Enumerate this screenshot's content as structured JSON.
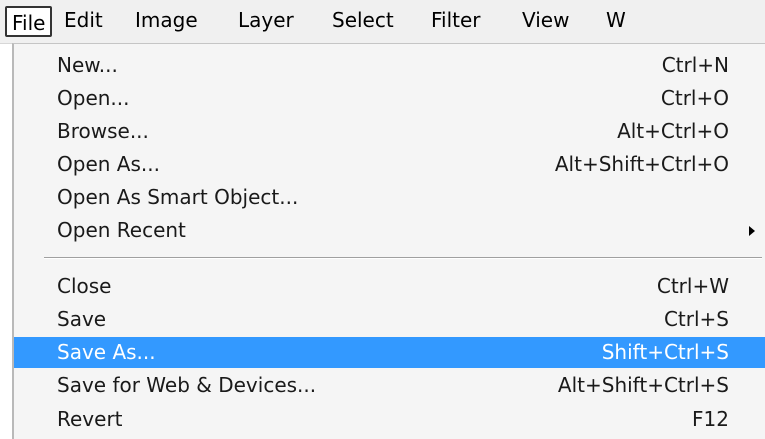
{
  "menubar": {
    "items": [
      {
        "label": "File",
        "active": true
      },
      {
        "label": "Edit"
      },
      {
        "label": "Image"
      },
      {
        "label": "Layer"
      },
      {
        "label": "Select"
      },
      {
        "label": "Filter"
      },
      {
        "label": "View"
      },
      {
        "label": "W"
      }
    ]
  },
  "file_menu": {
    "items": [
      {
        "label": "New...",
        "shortcut": "Ctrl+N"
      },
      {
        "label": "Open...",
        "shortcut": "Ctrl+O"
      },
      {
        "label": "Browse...",
        "shortcut": "Alt+Ctrl+O"
      },
      {
        "label": "Open As...",
        "shortcut": "Alt+Shift+Ctrl+O"
      },
      {
        "label": "Open As Smart Object...",
        "shortcut": ""
      },
      {
        "label": "Open Recent",
        "shortcut": "",
        "submenu_icon": "submenu-arrow-icon"
      },
      {
        "label": "Close",
        "shortcut": "Ctrl+W"
      },
      {
        "label": "Save",
        "shortcut": "Ctrl+S"
      },
      {
        "label": "Save As...",
        "shortcut": "Shift+Ctrl+S",
        "highlighted": true
      },
      {
        "label": "Save for Web & Devices...",
        "shortcut": "Alt+Shift+Ctrl+S"
      },
      {
        "label": "Revert",
        "shortcut": "F12"
      }
    ]
  },
  "colors": {
    "highlight": "#3399ff",
    "menu_background": "#f5f5f5",
    "menubar_background": "#f0f0f0"
  }
}
